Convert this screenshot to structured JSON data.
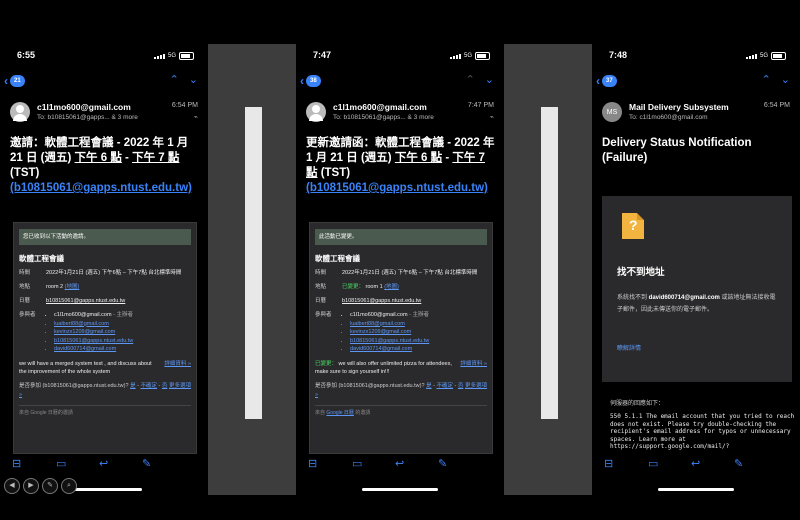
{
  "phone1": {
    "time": "6:55",
    "network": "5G",
    "back_count": "21",
    "from": "c1l1mo600@gmail.com",
    "to": "To: b10815061@gapps... & 3 more",
    "sent": "6:54 PM",
    "subject_pre": "邀請：軟體工程會議 - 2022 年 1 月 21 日 (週五) ",
    "subject_t1": "下午 6 點",
    "subject_dash": " - ",
    "subject_t2": "下午 7 點",
    "subject_tz": " (TST)",
    "subject_email": "(b10815061@gapps.ntust.edu.tw)",
    "banner": "您已收到以下活動的邀請。",
    "event_name": "軟體工程會議",
    "time_label": "時間",
    "time_value": "2022年1月21日 (週五) 下午6點 – 下午7點 台北標準時間",
    "place_label": "地點",
    "place_value": "room 2",
    "map": "(地圖)",
    "cal_label": "日曆",
    "cal_value": "b10815061@gapps.ntust.edu.tw",
    "att_label": "參與者",
    "att_first": "c1l1mo600@gmail.com",
    "organizer": "- 主辦者",
    "attendees": [
      "luaibert88@gmail.com",
      "kevinzx1209@gmail.com",
      "b10815061@gapps.ntust.edu.tw",
      "david600714@gmail.com"
    ],
    "note": "we will have a merged system test , and discuss about the improvement of the whole system",
    "details": "詳細資料 »",
    "rsvp_q": "是否參加 (b10815061@gapps.ntust.edu.tw)?",
    "yes": "是",
    "maybe": "不確定",
    "no": "否",
    "more": "更多選項 »",
    "footer": "來自 Google 日曆的邀請"
  },
  "phone2": {
    "time": "7:47",
    "network": "5G",
    "back_count": "38",
    "from": "c1l1mo600@gmail.com",
    "to": "To: b10815061@gapps... & 3 more",
    "sent": "7:47 PM",
    "subject_pre": "更新邀請函：軟體工程會議 - 2022 年 1 月 21 日 (週五) ",
    "subject_t1": "下午 6 點",
    "subject_dash": " - ",
    "subject_t2": "下午 7 點",
    "subject_tz": " (TST)",
    "subject_email": "(b10815061@gapps.ntust.edu.tw)",
    "banner": "此活動已變更。",
    "event_name": "軟體工程會議",
    "time_label": "時間",
    "time_value": "2022年1月21日 (週五) 下午6點 – 下午7點 台北標準時間",
    "place_label": "地點",
    "changed": "已變更：",
    "place_value": "room 1",
    "map": "(地圖)",
    "cal_label": "日曆",
    "cal_value": "b10815061@gapps.ntust.edu.tw",
    "att_label": "參與者",
    "att_first": "c1l1mo600@gmail.com",
    "organizer": "- 主辦者",
    "attendees": [
      "luaibert88@gmail.com",
      "kevinzx1209@gmail.com",
      "b10815061@gapps.ntust.edu.tw",
      "david600714@gmail.com"
    ],
    "note_changed": "已變更：",
    "note": "we will also offer unlimited pizza for attendees, make sure to sign yourself in!!!",
    "details": "詳細資料 »",
    "rsvp_q": "是否參加 (b10815061@gapps.ntust.edu.tw)?",
    "yes": "是",
    "maybe": "不確定",
    "no": "否",
    "more": "更多選項 »",
    "footer_pre": "來自",
    "footer_link": "Google 日曆",
    "footer_post": "的邀請"
  },
  "phone3": {
    "time": "7:48",
    "network": "5G",
    "back_count": "37",
    "avatar": "MS",
    "from": "Mail Delivery Subsystem",
    "to": "To: c1l1mo600@gmail.com",
    "sent": "6:54 PM",
    "subject": "Delivery Status Notification (Failure)",
    "heading": "找不到地址",
    "body_pre": "系統找不到 ",
    "body_email": "david600714@gmail.com",
    "body_post": " 或該地址無法接收電子郵件，因此未傳送你的電子郵件。",
    "learn_more": "瞭解詳情",
    "server_resp": "伺服器的回應如下：",
    "code": "550 5.1.1 The email account that you tried to reach does not exist. Please try double-checking the recipient's email address for typos or unnecessary spaces. Learn more at https://support.google.com/mail/?"
  }
}
